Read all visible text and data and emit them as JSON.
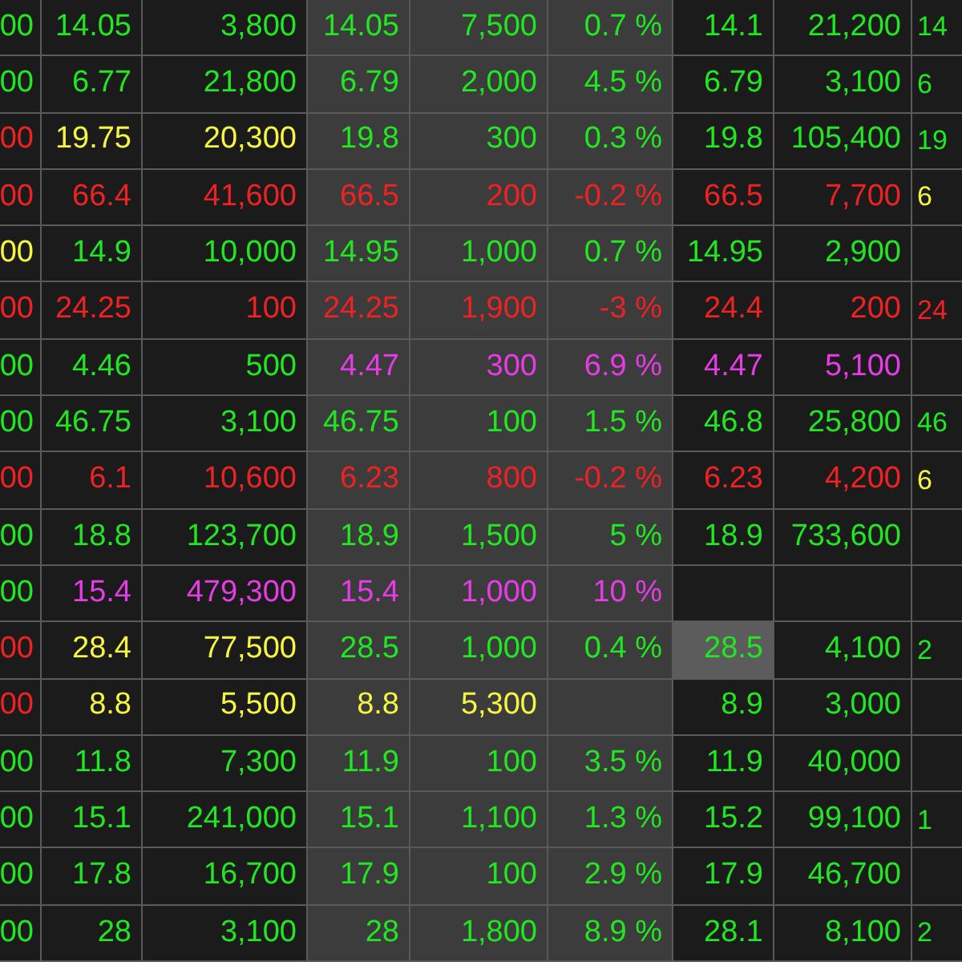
{
  "table": {
    "rows": [
      {
        "cells": [
          {
            "text": "00",
            "color": "#22e622"
          },
          {
            "text": "14.05",
            "color": "#22e622"
          },
          {
            "text": "3,800",
            "color": "#22e622"
          },
          {
            "text": "14.05",
            "color": "#22e622"
          },
          {
            "text": "7,500",
            "color": "#22e622"
          },
          {
            "text": "0.7 %",
            "color": "#22e622"
          },
          {
            "text": "14.1",
            "color": "#22e622"
          },
          {
            "text": "21,200",
            "color": "#22e622"
          },
          {
            "text": "14",
            "color": "#22e622"
          }
        ]
      },
      {
        "cells": [
          {
            "text": "00",
            "color": "#22e622"
          },
          {
            "text": "6.77",
            "color": "#22e622"
          },
          {
            "text": "21,800",
            "color": "#22e622"
          },
          {
            "text": "6.79",
            "color": "#22e622"
          },
          {
            "text": "2,000",
            "color": "#22e622"
          },
          {
            "text": "4.5 %",
            "color": "#22e622"
          },
          {
            "text": "6.79",
            "color": "#22e622"
          },
          {
            "text": "3,100",
            "color": "#22e622"
          },
          {
            "text": "6",
            "color": "#22e622"
          }
        ]
      },
      {
        "cells": [
          {
            "text": "00",
            "color": "#ee2222"
          },
          {
            "text": "19.75",
            "color": "#f5f542"
          },
          {
            "text": "20,300",
            "color": "#f5f542"
          },
          {
            "text": "19.8",
            "color": "#22e622"
          },
          {
            "text": "300",
            "color": "#22e622"
          },
          {
            "text": "0.3 %",
            "color": "#22e622"
          },
          {
            "text": "19.8",
            "color": "#22e622"
          },
          {
            "text": "105,400",
            "color": "#22e622"
          },
          {
            "text": "19",
            "color": "#22e622"
          }
        ]
      },
      {
        "cells": [
          {
            "text": "00",
            "color": "#ee2222"
          },
          {
            "text": "66.4",
            "color": "#ee2222"
          },
          {
            "text": "41,600",
            "color": "#ee2222"
          },
          {
            "text": "66.5",
            "color": "#ee2222"
          },
          {
            "text": "200",
            "color": "#ee2222"
          },
          {
            "text": "-0.2 %",
            "color": "#ee2222"
          },
          {
            "text": "66.5",
            "color": "#ee2222"
          },
          {
            "text": "7,700",
            "color": "#ee2222"
          },
          {
            "text": "6",
            "color": "#f5f542"
          }
        ]
      },
      {
        "cells": [
          {
            "text": "00",
            "color": "#f5f542"
          },
          {
            "text": "14.9",
            "color": "#22e622"
          },
          {
            "text": "10,000",
            "color": "#22e622"
          },
          {
            "text": "14.95",
            "color": "#22e622"
          },
          {
            "text": "1,000",
            "color": "#22e622"
          },
          {
            "text": "0.7 %",
            "color": "#22e622"
          },
          {
            "text": "14.95",
            "color": "#22e622"
          },
          {
            "text": "2,900",
            "color": "#22e622"
          },
          null
        ]
      },
      {
        "cells": [
          {
            "text": "00",
            "color": "#ee2222"
          },
          {
            "text": "24.25",
            "color": "#ee2222"
          },
          {
            "text": "100",
            "color": "#ee2222"
          },
          {
            "text": "24.25",
            "color": "#ee2222"
          },
          {
            "text": "1,900",
            "color": "#ee2222"
          },
          {
            "text": "-3 %",
            "color": "#ee2222"
          },
          {
            "text": "24.4",
            "color": "#ee2222"
          },
          {
            "text": "200",
            "color": "#ee2222"
          },
          {
            "text": "24",
            "color": "#ee2222"
          }
        ]
      },
      {
        "cells": [
          {
            "text": "00",
            "color": "#22e622"
          },
          {
            "text": "4.46",
            "color": "#22e622"
          },
          {
            "text": "500",
            "color": "#22e622"
          },
          {
            "text": "4.47",
            "color": "#e63ce6"
          },
          {
            "text": "300",
            "color": "#e63ce6"
          },
          {
            "text": "6.9 %",
            "color": "#e63ce6"
          },
          {
            "text": "4.47",
            "color": "#e63ce6"
          },
          {
            "text": "5,100",
            "color": "#e63ce6"
          },
          null
        ]
      },
      {
        "cells": [
          {
            "text": "00",
            "color": "#22e622"
          },
          {
            "text": "46.75",
            "color": "#22e622"
          },
          {
            "text": "3,100",
            "color": "#22e622"
          },
          {
            "text": "46.75",
            "color": "#22e622"
          },
          {
            "text": "100",
            "color": "#22e622"
          },
          {
            "text": "1.5 %",
            "color": "#22e622"
          },
          {
            "text": "46.8",
            "color": "#22e622"
          },
          {
            "text": "25,800",
            "color": "#22e622"
          },
          {
            "text": "46",
            "color": "#22e622"
          }
        ]
      },
      {
        "cells": [
          {
            "text": "00",
            "color": "#ee2222"
          },
          {
            "text": "6.1",
            "color": "#ee2222"
          },
          {
            "text": "10,600",
            "color": "#ee2222"
          },
          {
            "text": "6.23",
            "color": "#ee2222"
          },
          {
            "text": "800",
            "color": "#ee2222"
          },
          {
            "text": "-0.2 %",
            "color": "#ee2222"
          },
          {
            "text": "6.23",
            "color": "#ee2222"
          },
          {
            "text": "4,200",
            "color": "#ee2222"
          },
          {
            "text": "6",
            "color": "#f5f542"
          }
        ]
      },
      {
        "cells": [
          {
            "text": "00",
            "color": "#22e622"
          },
          {
            "text": "18.8",
            "color": "#22e622"
          },
          {
            "text": "123,700",
            "color": "#22e622"
          },
          {
            "text": "18.9",
            "color": "#22e622"
          },
          {
            "text": "1,500",
            "color": "#22e622"
          },
          {
            "text": "5 %",
            "color": "#22e622"
          },
          {
            "text": "18.9",
            "color": "#22e622"
          },
          {
            "text": "733,600",
            "color": "#22e622"
          },
          null
        ]
      },
      {
        "cells": [
          {
            "text": "00",
            "color": "#22e622"
          },
          {
            "text": "15.4",
            "color": "#e63ce6"
          },
          {
            "text": "479,300",
            "color": "#e63ce6"
          },
          {
            "text": "15.4",
            "color": "#e63ce6"
          },
          {
            "text": "1,000",
            "color": "#e63ce6"
          },
          {
            "text": "10 %",
            "color": "#e63ce6"
          },
          null,
          null,
          null
        ]
      },
      {
        "cells": [
          {
            "text": "00",
            "color": "#ee2222"
          },
          {
            "text": "28.4",
            "color": "#f5f542"
          },
          {
            "text": "77,500",
            "color": "#f5f542"
          },
          {
            "text": "28.5",
            "color": "#22e622"
          },
          {
            "text": "1,000",
            "color": "#22e622"
          },
          {
            "text": "0.4 %",
            "color": "#22e622"
          },
          {
            "text": "28.5",
            "color": "#22e622",
            "highlighted": true
          },
          {
            "text": "4,100",
            "color": "#22e622"
          },
          {
            "text": "2",
            "color": "#22e622"
          }
        ]
      },
      {
        "cells": [
          {
            "text": "00",
            "color": "#ee2222"
          },
          {
            "text": "8.8",
            "color": "#f5f542"
          },
          {
            "text": "5,500",
            "color": "#f5f542"
          },
          {
            "text": "8.8",
            "color": "#f5f542"
          },
          {
            "text": "5,300",
            "color": "#f5f542"
          },
          null,
          {
            "text": "8.9",
            "color": "#22e622"
          },
          {
            "text": "3,000",
            "color": "#22e622"
          },
          null
        ]
      },
      {
        "cells": [
          {
            "text": "00",
            "color": "#22e622"
          },
          {
            "text": "11.8",
            "color": "#22e622"
          },
          {
            "text": "7,300",
            "color": "#22e622"
          },
          {
            "text": "11.9",
            "color": "#22e622"
          },
          {
            "text": "100",
            "color": "#22e622"
          },
          {
            "text": "3.5 %",
            "color": "#22e622"
          },
          {
            "text": "11.9",
            "color": "#22e622"
          },
          {
            "text": "40,000",
            "color": "#22e622"
          },
          null
        ]
      },
      {
        "cells": [
          {
            "text": "00",
            "color": "#22e622"
          },
          {
            "text": "15.1",
            "color": "#22e622"
          },
          {
            "text": "241,000",
            "color": "#22e622"
          },
          {
            "text": "15.1",
            "color": "#22e622"
          },
          {
            "text": "1,100",
            "color": "#22e622"
          },
          {
            "text": "1.3 %",
            "color": "#22e622"
          },
          {
            "text": "15.2",
            "color": "#22e622"
          },
          {
            "text": "99,100",
            "color": "#22e622"
          },
          {
            "text": "1",
            "color": "#22e622"
          }
        ]
      },
      {
        "cells": [
          {
            "text": "00",
            "color": "#22e622"
          },
          {
            "text": "17.8",
            "color": "#22e622"
          },
          {
            "text": "16,700",
            "color": "#22e622"
          },
          {
            "text": "17.9",
            "color": "#22e622"
          },
          {
            "text": "100",
            "color": "#22e622"
          },
          {
            "text": "2.9 %",
            "color": "#22e622"
          },
          {
            "text": "17.9",
            "color": "#22e622"
          },
          {
            "text": "46,700",
            "color": "#22e622"
          },
          null
        ]
      },
      {
        "cells": [
          {
            "text": "00",
            "color": "#22e622"
          },
          {
            "text": "28",
            "color": "#22e622"
          },
          {
            "text": "3,100",
            "color": "#22e622"
          },
          {
            "text": "28",
            "color": "#22e622"
          },
          {
            "text": "1,800",
            "color": "#22e622"
          },
          {
            "text": "8.9 %",
            "color": "#22e622"
          },
          {
            "text": "28.1",
            "color": "#22e622"
          },
          {
            "text": "8,100",
            "color": "#22e622"
          },
          {
            "text": "2",
            "color": "#22e622"
          }
        ]
      }
    ]
  }
}
